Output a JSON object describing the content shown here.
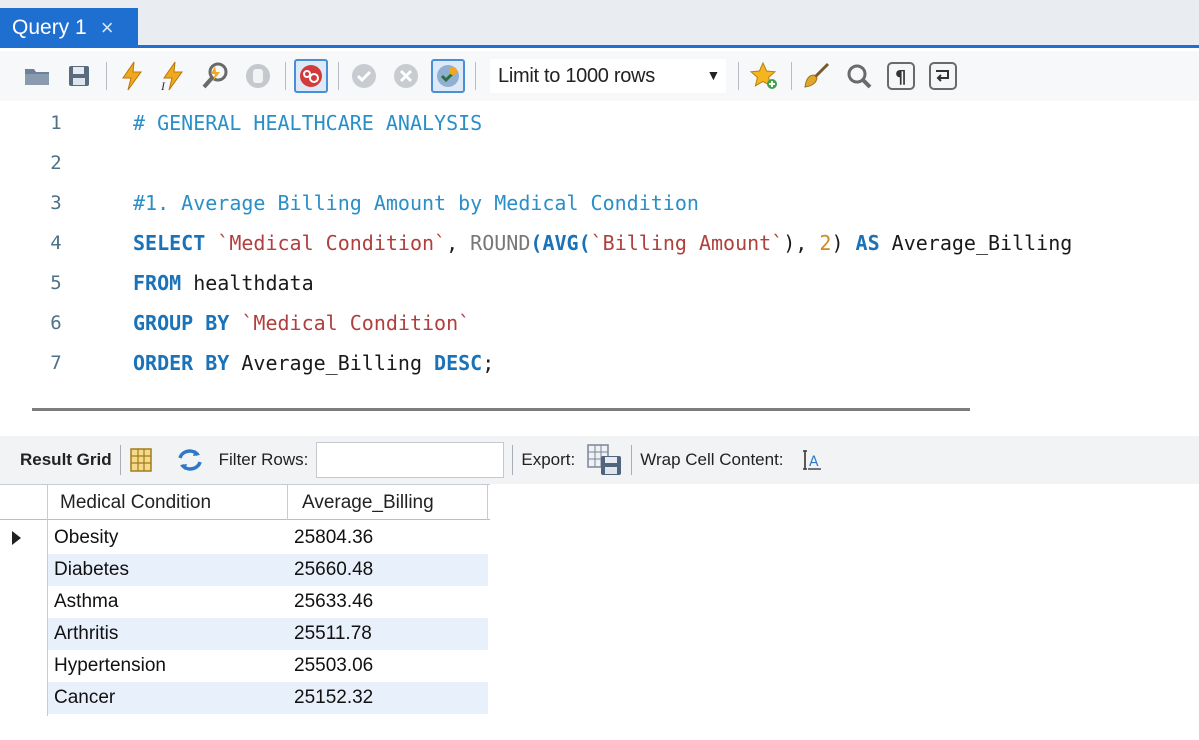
{
  "tab": {
    "title": "Query 1",
    "close": "×"
  },
  "toolbar": {
    "limit_select": "Limit to 1000 rows",
    "icons": [
      "open-folder-icon",
      "save-icon",
      "execute-icon",
      "execute-current-icon",
      "explain-icon",
      "stop-icon",
      "toggle-stop-on-error-icon",
      "commit-icon",
      "rollback-icon",
      "autocommit-icon",
      "favorite-star-icon",
      "beautify-brush-icon",
      "find-icon",
      "invisible-chars-icon",
      "wrap-lines-icon"
    ]
  },
  "editor": {
    "lines": [
      {
        "n": "1",
        "comment": "# GENERAL HEALTHCARE ANALYSIS"
      },
      {
        "n": "2"
      },
      {
        "n": "3",
        "comment": "#1. Average Billing Amount by Medical Condition"
      },
      {
        "n": "4",
        "kw1": "SELECT",
        "str1": "`Medical Condition`",
        "p1": ", ",
        "fn1": "ROUND",
        "paren1": "(",
        "kw2": "AVG",
        "paren2": "(",
        "str2": "`Billing Amount`",
        "p2": "), ",
        "num": "2",
        "p3": ") ",
        "kw3": "AS",
        "id": " Average_Billing"
      },
      {
        "n": "5",
        "kw1": "FROM",
        "id": " healthdata"
      },
      {
        "n": "6",
        "kw1": "GROUP BY",
        "str1": " `Medical Condition`"
      },
      {
        "n": "7",
        "kw1": "ORDER BY",
        "id": " Average_Billing ",
        "kw2": "DESC",
        "p": ";"
      }
    ]
  },
  "result_toolbar": {
    "result_grid": "Result Grid",
    "filter_rows": "Filter Rows:",
    "filter_value": "",
    "export": "Export:",
    "wrap": "Wrap Cell Content:"
  },
  "grid": {
    "columns": [
      "Medical Condition",
      "Average_Billing"
    ],
    "rows": [
      [
        "Obesity",
        "25804.36"
      ],
      [
        "Diabetes",
        "25660.48"
      ],
      [
        "Asthma",
        "25633.46"
      ],
      [
        "Arthritis",
        "25511.78"
      ],
      [
        "Hypertension",
        "25503.06"
      ],
      [
        "Cancer",
        "25152.32"
      ]
    ]
  },
  "colors": {
    "accent": "#1f6fd1",
    "alt_row": "#e8f0fb"
  }
}
